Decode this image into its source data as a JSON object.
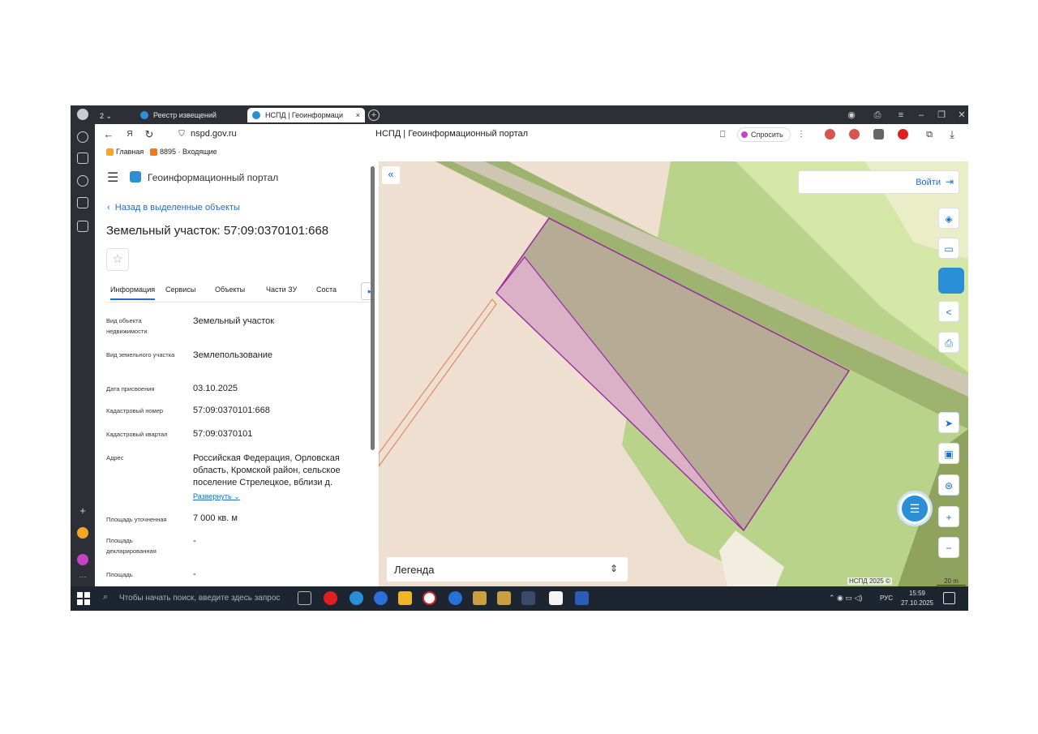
{
  "browser": {
    "tabs": [
      {
        "label": "Реестр извещений"
      },
      {
        "label": "НСПД | Геоинформаци",
        "close": "×"
      }
    ],
    "tab_counter": "2",
    "url": "nspd.gov.ru",
    "page_title": "НСПД | Геоинформационный портал",
    "ask_label": "Спросить",
    "bookmarks": [
      {
        "label": "Главная"
      },
      {
        "label": "8895 · Входящие"
      }
    ],
    "colors": {
      "accent": "#1a6fd1",
      "chrome": "#2c3036"
    }
  },
  "panel": {
    "portal_name": "Геоинформационный портал",
    "back_label": "Назад в выделенные объекты",
    "title": "Земельный участок: 57:09:0370101:668",
    "tabs": [
      "Информация",
      "Сервисы",
      "Объекты",
      "Части ЗУ",
      "Соста"
    ],
    "rows": [
      {
        "label": "Вид объекта недвижимости",
        "value": "Земельный участок"
      },
      {
        "label": "Вид земельного участка",
        "value": "Землепользование"
      },
      {
        "label": "Дата присвоения",
        "value": "03.10.2025"
      },
      {
        "label": "Кадастровый номер",
        "value": "57:09:0370101:668"
      },
      {
        "label": "Кадастровый квартал",
        "value": "57:09:0370101"
      },
      {
        "label": "Адрес",
        "value": "Российская Федерация, Орловская область, Кромской район, сельское поселение Стрелецкое, вблизи д."
      },
      {
        "label": "Площадь уточненная",
        "value": "7 000 кв. м"
      },
      {
        "label": "Площадь декларированная",
        "value": "-"
      },
      {
        "label": "Площадь",
        "value": "-"
      }
    ],
    "expand_label": "Развернуть"
  },
  "map": {
    "login_label": "Войти",
    "legend_label": "Легенда",
    "copyright": "НСПД 2025 ©",
    "scale": "20 m"
  },
  "taskbar": {
    "search_placeholder": "Чтобы начать поиск, введите здесь запрос",
    "lang": "РУС",
    "time": "15:59",
    "date": "27.10.2025"
  }
}
